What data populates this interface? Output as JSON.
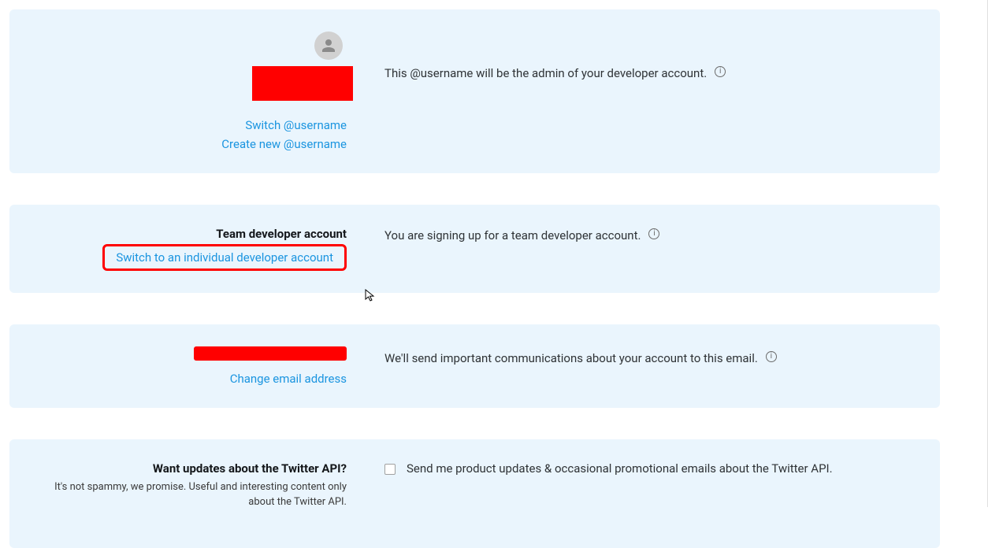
{
  "user": {
    "switch_link": "Switch @username",
    "create_link": "Create new @username",
    "desc": "This @username will be the admin of your developer account."
  },
  "team": {
    "heading": "Team developer account",
    "switch_link": "Switch to an individual developer account",
    "desc": "You are signing up for a team developer account."
  },
  "email": {
    "change_link": "Change email address",
    "desc": "We'll send important communications about your account to this email."
  },
  "updates": {
    "heading": "Want updates about the Twitter API?",
    "subtext": "It's not spammy, we promise. Useful and interesting content only about the Twitter API.",
    "checkbox_label": "Send me product updates & occasional promotional emails about the Twitter API."
  }
}
